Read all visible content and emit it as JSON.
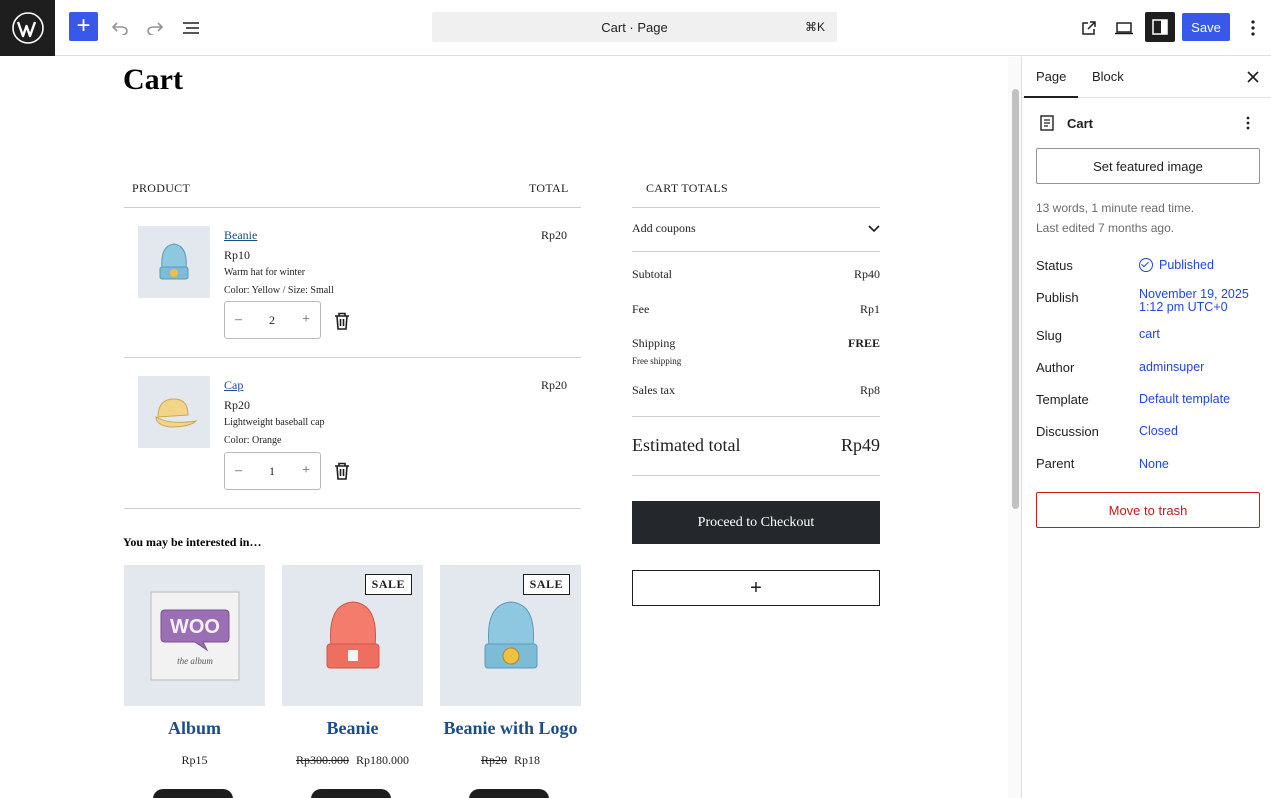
{
  "topbar": {
    "command_label": "Cart · Page",
    "command_shortcut": "⌘K",
    "save_label": "Save",
    "accent": "#3858e9"
  },
  "cart": {
    "page_title": "Cart",
    "col_product": "PRODUCT",
    "col_total": "TOTAL",
    "items": [
      {
        "name": "Beanie",
        "price": "Rp10",
        "desc": "Warm hat for winter",
        "variation": "Color: Yellow / Size: Small",
        "qty": "2",
        "total": "Rp20"
      },
      {
        "name": "Cap",
        "price": "Rp20",
        "desc": "Lightweight baseball cap",
        "variation": "Color: Orange",
        "qty": "1",
        "total": "Rp20"
      }
    ],
    "qty_minus": "–",
    "qty_plus": "+"
  },
  "totals": {
    "heading": "CART TOTALS",
    "coupons": "Add coupons",
    "subtotal_label": "Subtotal",
    "subtotal": "Rp40",
    "fee_label": "Fee",
    "fee": "Rp1",
    "shipping_label": "Shipping",
    "shipping": "FREE",
    "shipping_note": "Free shipping",
    "tax_label": "Sales tax",
    "tax": "Rp8",
    "estimated_label": "Estimated total",
    "estimated": "Rp49",
    "checkout_label": "Proceed to Checkout",
    "add_block": "+"
  },
  "interest": {
    "heading": "You may be interested in…",
    "products": [
      {
        "name": "Album",
        "price": "Rp15",
        "old_price": "",
        "sale": ""
      },
      {
        "name": "Beanie",
        "price": "Rp180.000",
        "old_price": "Rp300.000",
        "sale": "SALE"
      },
      {
        "name": "Beanie with Logo",
        "price": "Rp18",
        "old_price": "Rp20",
        "sale": "SALE"
      }
    ],
    "album_text": "WOO",
    "album_sub": "the album"
  },
  "sidebar": {
    "tab_page": "Page",
    "tab_block": "Block",
    "doc_title": "Cart",
    "featured_label": "Set featured image",
    "meta_words": "13 words, 1 minute read time.",
    "meta_edited": "Last edited 7 months ago.",
    "status_label": "Status",
    "status_value": "Published",
    "publish_label": "Publish",
    "publish_line1": "November 19, 2025",
    "publish_line2": "1:12 pm UTC+0",
    "slug_label": "Slug",
    "slug_value": "cart",
    "author_label": "Author",
    "author_value": "adminsuper",
    "template_label": "Template",
    "template_value": "Default template",
    "discussion_label": "Discussion",
    "discussion_value": "Closed",
    "parent_label": "Parent",
    "parent_value": "None",
    "trash_label": "Move to trash"
  },
  "icons": {
    "wordpress": "wordpress-logo-icon",
    "add": "plus-icon",
    "undo": "undo-icon",
    "redo": "redo-icon",
    "list": "list-view-icon",
    "view": "external-link-icon",
    "device": "desktop-preview-icon",
    "settings": "sidebar-toggle-icon",
    "more": "more-vertical-icon",
    "trash": "trash-icon",
    "chevron": "chevron-down-icon",
    "close": "close-icon",
    "doc": "page-icon"
  }
}
